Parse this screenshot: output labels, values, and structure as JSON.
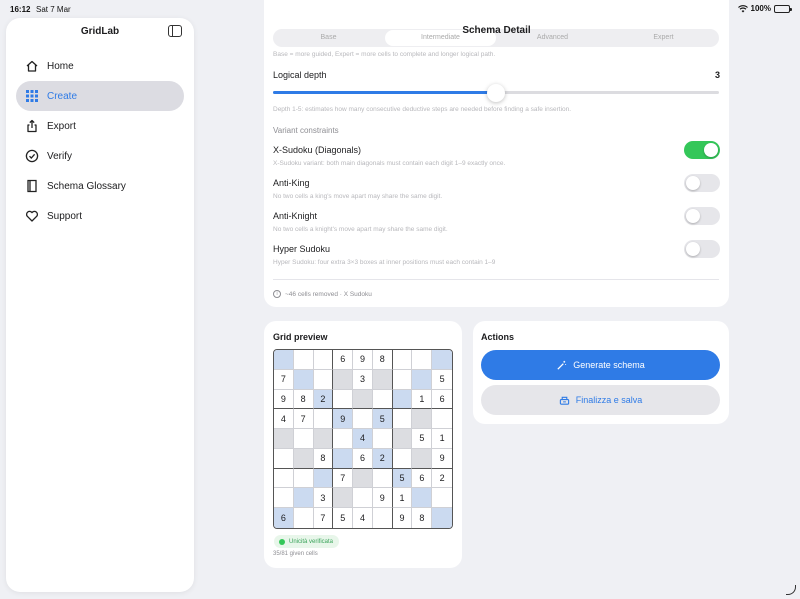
{
  "status": {
    "time": "16:12",
    "date": "Sat 7 Mar",
    "battery": "100%",
    "icons": [
      "wifi-icon",
      "battery-icon"
    ]
  },
  "sidebar": {
    "title": "GridLab",
    "items": [
      {
        "label": "Home",
        "icon": "house-icon",
        "active": false
      },
      {
        "label": "Create",
        "icon": "grid-icon",
        "active": true
      },
      {
        "label": "Export",
        "icon": "share-icon",
        "active": false
      },
      {
        "label": "Verify",
        "icon": "check-badge-icon",
        "active": false
      },
      {
        "label": "Schema Glossary",
        "icon": "book-icon",
        "active": false
      },
      {
        "label": "Support",
        "icon": "heart-icon",
        "active": false
      }
    ]
  },
  "detail": {
    "nav_title": "Schema Detail",
    "difficulty": {
      "options": [
        "Base",
        "Intermediate",
        "Advanced",
        "Expert"
      ],
      "selected": "Intermediate",
      "hint": "Base = more guided, Expert = more cells to complete and longer logical path."
    },
    "logical_depth": {
      "label": "Logical depth",
      "value": "3",
      "level": 0.5,
      "hint": "Depth 1-5: estimates how many consecutive deductive steps are needed before finding a safe insertion."
    },
    "variants_caption": "Variant constraints",
    "variants": [
      {
        "label": "X-Sudoku (Diagonals)",
        "hint": "X-Sudoku variant: both main diagonals must contain each digit 1–9 exactly once.",
        "on": true
      },
      {
        "label": "Anti-King",
        "hint": "No two cells a king's move apart may share the same digit.",
        "on": false
      },
      {
        "label": "Anti-Knight",
        "hint": "No two cells a knight's move apart may share the same digit.",
        "on": false
      },
      {
        "label": "Hyper Sudoku",
        "hint": "Hyper Sudoku: four extra 3×3 boxes at inner positions must each contain 1–9",
        "on": false
      }
    ],
    "footer_note": "~46 cells removed · X Sudoku"
  },
  "preview": {
    "title": "Grid preview",
    "grid": [
      [
        "",
        "",
        "",
        "6",
        "9",
        "8",
        "",
        "",
        ""
      ],
      [
        "7",
        "",
        "",
        "",
        "3",
        "",
        "",
        "",
        "5"
      ],
      [
        "9",
        "8",
        "2",
        "",
        "",
        "",
        "",
        "1",
        "6"
      ],
      [
        "4",
        "7",
        "",
        "9",
        "",
        "5",
        "",
        "",
        ""
      ],
      [
        "",
        "",
        "",
        "",
        "4",
        "",
        "",
        "5",
        "1"
      ],
      [
        "",
        "",
        "8",
        "",
        "6",
        "2",
        "",
        "",
        "9"
      ],
      [
        "",
        "",
        "",
        "7",
        "",
        "",
        "5",
        "6",
        "2"
      ],
      [
        "",
        "",
        "3",
        "",
        "",
        "9",
        "1",
        "",
        ""
      ],
      [
        "6",
        "",
        "7",
        "5",
        "4",
        "",
        "9",
        "8",
        ""
      ]
    ],
    "badge": "Unicità verificata",
    "given": "35/81 given cells"
  },
  "actions": {
    "title": "Actions",
    "generate_label": "Generate schema",
    "save_label": "Finalizza e salva"
  },
  "colors": {
    "accent": "#2f7be6",
    "toggle_on": "#34c759",
    "diagonal": "#cbdaf0",
    "shaded": "#dcdde1"
  }
}
